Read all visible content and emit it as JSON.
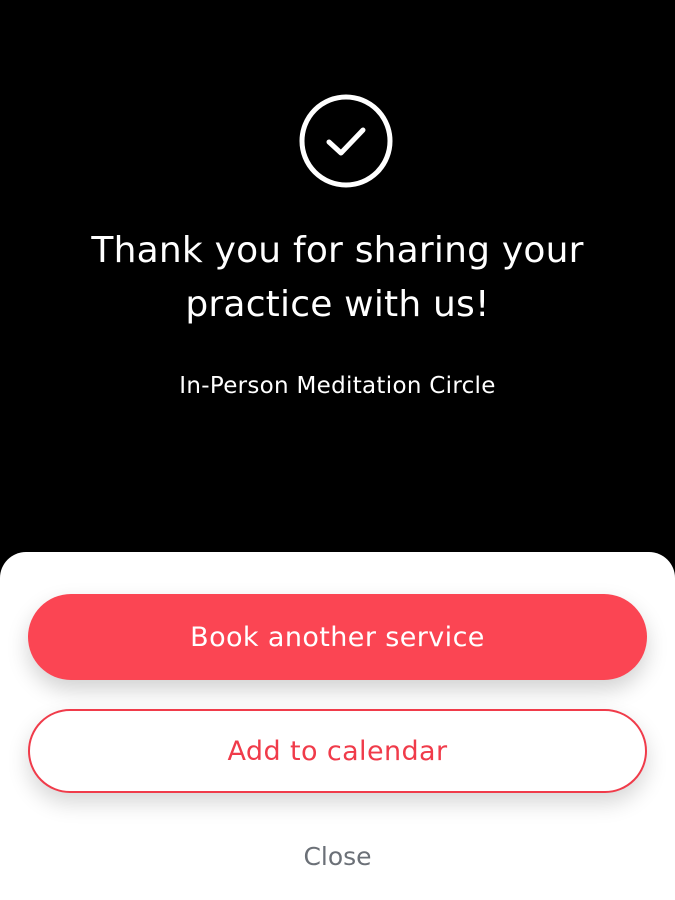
{
  "confirmation": {
    "icon": "check-circle-icon",
    "title": "Thank you for sharing your practice with us!",
    "service_name": "In-Person Meditation Circle"
  },
  "actions": {
    "book_another_label": "Book another service",
    "add_to_calendar_label": "Add to calendar",
    "close_label": "Close"
  },
  "colors": {
    "background": "#000000",
    "sheet": "#ffffff",
    "accent": "#fb4553",
    "close_text": "#6b7077"
  }
}
